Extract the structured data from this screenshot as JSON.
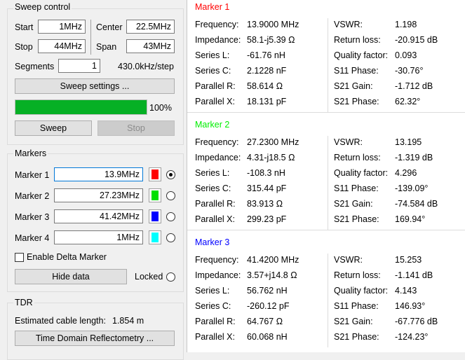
{
  "sweep": {
    "title": "Sweep control",
    "start_label": "Start",
    "start_value": "1MHz",
    "stop_label": "Stop",
    "stop_value": "44MHz",
    "center_label": "Center",
    "center_value": "22.5MHz",
    "span_label": "Span",
    "span_value": "43MHz",
    "segments_label": "Segments",
    "segments_value": "1",
    "step_text": "430.0kHz/step",
    "settings_button": "Sweep settings ...",
    "progress": 100,
    "progress_text": "100%",
    "progress_color": "#06b025",
    "sweep_button": "Sweep",
    "stop_button": "Stop"
  },
  "markers_box": {
    "title": "Markers",
    "markers": [
      {
        "label": "Marker 1",
        "value": "13.9MHz",
        "color": "#ff0000",
        "selected": true
      },
      {
        "label": "Marker 2",
        "value": "27.23MHz",
        "color": "#00e000",
        "selected": false
      },
      {
        "label": "Marker 3",
        "value": "41.42MHz",
        "color": "#0000ff",
        "selected": false
      },
      {
        "label": "Marker 4",
        "value": "1MHz",
        "color": "#00ffff",
        "selected": false
      }
    ],
    "delta_label": "Enable Delta Marker",
    "hide_button": "Hide data",
    "locked_label": "Locked"
  },
  "tdr": {
    "title": "TDR",
    "cable_label": "Estimated cable length:",
    "cable_value": "1.854 m",
    "button": "Time Domain Reflectometry ..."
  },
  "panel": {
    "left_labels": [
      "Frequency:",
      "Impedance:",
      "Series L:",
      "Series C:",
      "Parallel R:",
      "Parallel X:"
    ],
    "right_labels": [
      "VSWR:",
      "Return loss:",
      "Quality factor:",
      "S11 Phase:",
      "S21 Gain:",
      "S21 Phase:"
    ],
    "markers": [
      {
        "title": "Marker 1",
        "color": "#ff0000",
        "left_values": [
          "13.9000 MHz",
          "58.1-j5.39 Ω",
          "-61.76 nH",
          "2.1228 nF",
          "58.614 Ω",
          "18.131 pF"
        ],
        "right_values": [
          "1.198",
          "-20.915 dB",
          "0.093",
          "-30.76°",
          "-1.712 dB",
          "62.32°"
        ]
      },
      {
        "title": "Marker 2",
        "color": "#00ee00",
        "left_values": [
          "27.2300 MHz",
          "4.31-j18.5 Ω",
          "-108.3 nH",
          "315.44 pF",
          "83.913 Ω",
          "299.23 pF"
        ],
        "right_values": [
          "13.195",
          "-1.319 dB",
          "4.296",
          "-139.09°",
          "-74.584 dB",
          "169.94°"
        ]
      },
      {
        "title": "Marker 3",
        "color": "#0000ff",
        "left_values": [
          "41.4200 MHz",
          "3.57+j14.8 Ω",
          "56.762 nH",
          "-260.12 pF",
          "64.767 Ω",
          "60.068 nH"
        ],
        "right_values": [
          "15.253",
          "-1.141 dB",
          "4.143",
          "146.93°",
          "-67.776 dB",
          "-124.23°"
        ]
      }
    ]
  }
}
